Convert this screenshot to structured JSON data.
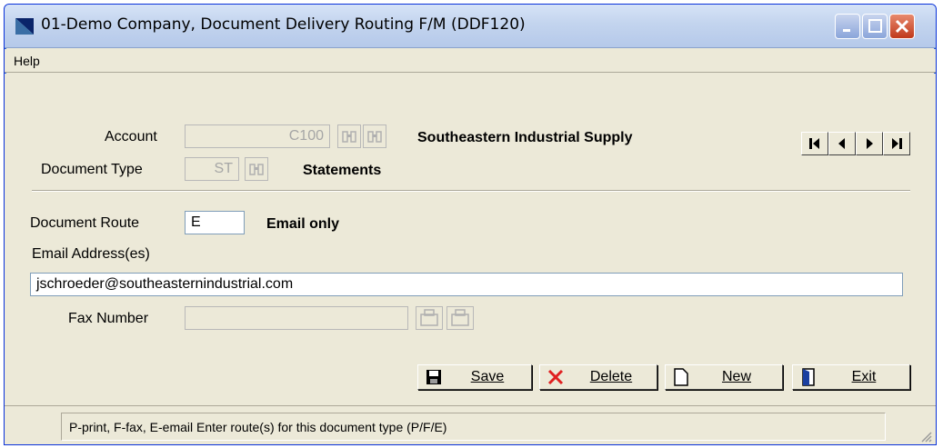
{
  "window": {
    "title": "01-Demo Company, Document Delivery Routing F/M (DDF120)"
  },
  "menu": {
    "help_label": "Help"
  },
  "form": {
    "account_label": "Account",
    "account_value": "C100",
    "account_description": "Southeastern Industrial Supply",
    "doctype_label": "Document Type",
    "doctype_value": "ST",
    "doctype_description": "Statements",
    "route_label": "Document Route",
    "route_value": "E",
    "route_description": "Email only",
    "email_label": "Email Address(es)",
    "email_value": "jschroeder@southeasternindustrial.com",
    "fax_label": "Fax Number",
    "fax_value": ""
  },
  "actions": {
    "save_label": "Save",
    "delete_label": "Delete",
    "new_label": "New",
    "exit_label": "Exit"
  },
  "status": {
    "message": "P-print, F-fax, E-email Enter route(s) for this document type (P/F/E)"
  },
  "colors": {
    "title_bar": "#c3d4ee",
    "window_bg": "#ece9d8",
    "close_button": "#c0391b",
    "delete_icon": "#e02020"
  },
  "icons": {
    "title": "app-icon",
    "lookup": "binoculars-icon",
    "fax_lookup": "fax-icon",
    "nav": [
      "first-record-icon",
      "previous-record-icon",
      "next-record-icon",
      "last-record-icon"
    ],
    "save": "floppy-disk-icon",
    "delete": "red-x-icon",
    "new": "blank-document-icon",
    "exit": "door-icon"
  }
}
